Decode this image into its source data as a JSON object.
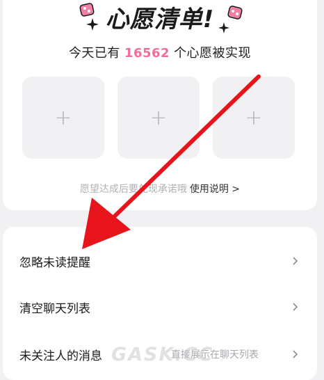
{
  "wish_card": {
    "title": "心愿清单!",
    "subtitle_prefix": "今天已有",
    "count": "16562",
    "subtitle_suffix": "个心愿被实现",
    "slot_symbol": "+",
    "hint": "愿望达成后要兑现承诺哦",
    "hint_link": "使用说明 >"
  },
  "menu": {
    "items": [
      {
        "label": "忽略未读提醒",
        "subtext": ""
      },
      {
        "label": "清空聊天列表",
        "subtext": ""
      },
      {
        "label": "未关注人的消息",
        "subtext": "直接展示在聊天列表"
      }
    ]
  },
  "watermark": "GASK.CC",
  "colors": {
    "accent_pink": "#ee6f9a",
    "arrow_red": "#e8141b",
    "background": "#f1f1f3"
  }
}
